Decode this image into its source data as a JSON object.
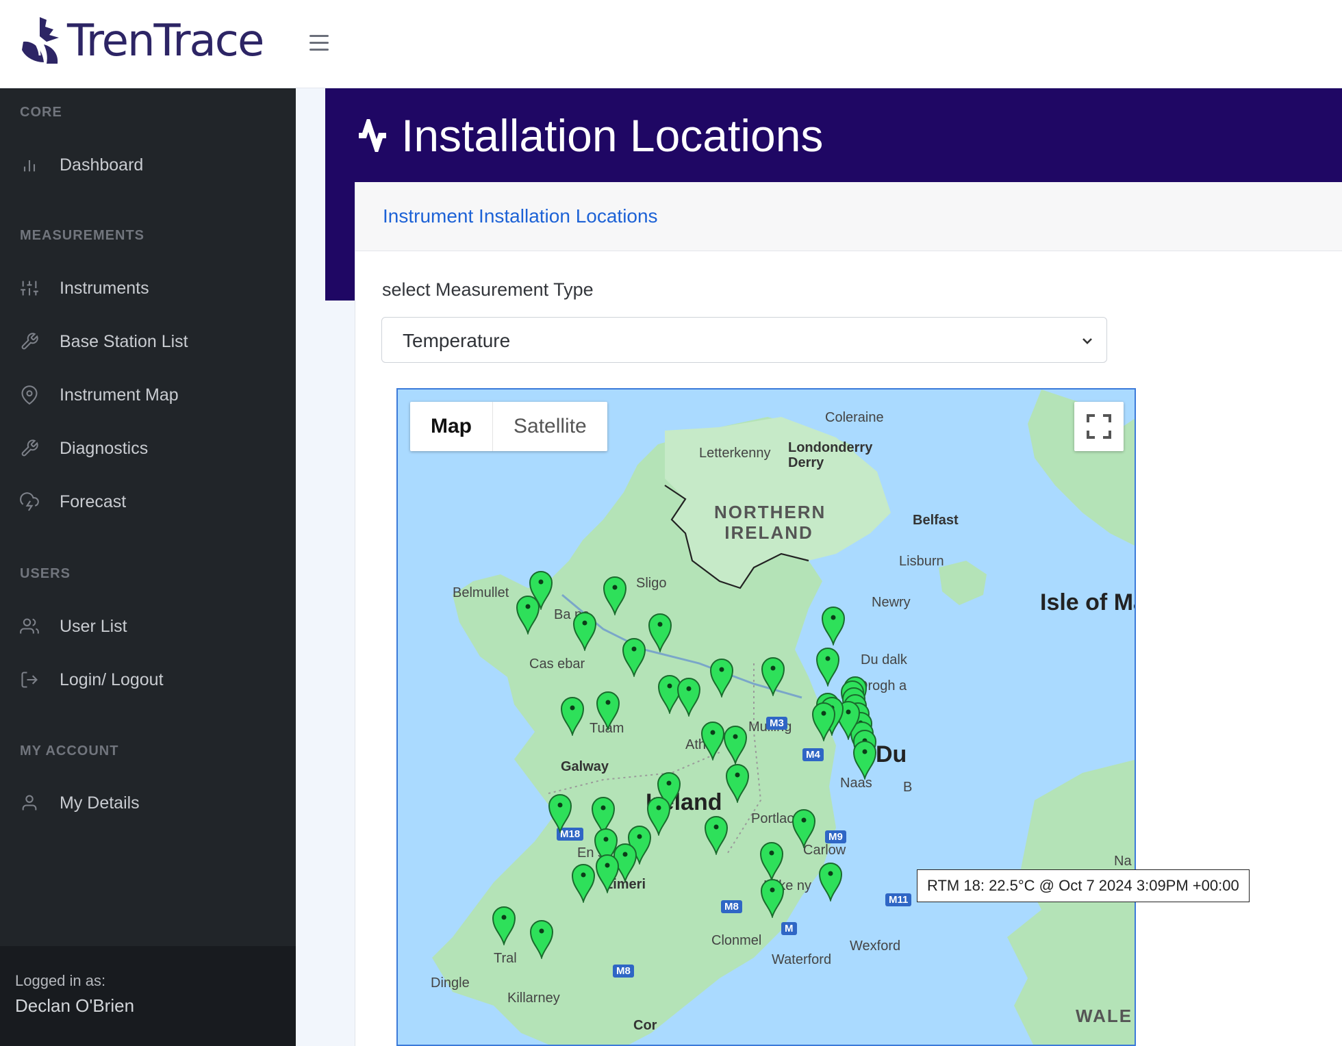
{
  "brand": {
    "name": "TrenTrace"
  },
  "sidebar": {
    "sections": [
      {
        "heading": "CORE",
        "items": [
          {
            "label": "Dashboard",
            "icon": "bar-chart-icon"
          }
        ]
      },
      {
        "heading": "MEASUREMENTS",
        "items": [
          {
            "label": "Instruments",
            "icon": "sliders-icon"
          },
          {
            "label": "Base Station List",
            "icon": "wrench-icon"
          },
          {
            "label": "Instrument Map",
            "icon": "map-pin-icon"
          },
          {
            "label": "Diagnostics",
            "icon": "wrench-icon"
          },
          {
            "label": "Forecast",
            "icon": "cloud-lightning-icon"
          }
        ]
      },
      {
        "heading": "USERS",
        "items": [
          {
            "label": "User List",
            "icon": "users-icon"
          },
          {
            "label": "Login/ Logout",
            "icon": "logout-icon"
          }
        ]
      },
      {
        "heading": "MY ACCOUNT",
        "items": [
          {
            "label": "My Details",
            "icon": "user-icon"
          }
        ]
      }
    ],
    "footer": {
      "logged_in_label": "Logged in as:",
      "user_name": "Declan O'Brien"
    }
  },
  "header": {
    "title": "Installation Locations",
    "icon": "activity-icon"
  },
  "card": {
    "title": "Instrument Installation Locations",
    "select_label": "select Measurement Type",
    "select_value": "Temperature"
  },
  "map": {
    "type_buttons": [
      "Map",
      "Satellite"
    ],
    "selected_type": "Map",
    "fullscreen_icon": "fullscreen-icon",
    "place_labels": {
      "coleraine": "Coleraine",
      "letterkenny": "Letterkenny",
      "londonderry": "Londonderry",
      "derry": "Derry",
      "northern_ireland": "NORTHERN IRELAND",
      "belfast": "Belfast",
      "lisburn": "Lisburn",
      "isle_of_man": "Isle of Ma",
      "belmullet": "Belmullet",
      "sligo": "Sligo",
      "newry": "Newry",
      "ballina": "Ba    na",
      "castlebar": "Cas   ebar",
      "dundalk": "Du    dalk",
      "drogheda": "Drogh     a",
      "tuam": "Tuam",
      "mullingar": "Mulling",
      "athlone": "Athl",
      "galway": "Galway",
      "naas": "Naas",
      "dublin": "Du",
      "bray": "B",
      "ireland": "Ireland",
      "portlaoise": "Portlaois",
      "ennis": "En   s",
      "carlow": "Carlow",
      "limerick": "Limeri",
      "kilkenny": "Kilke    ny",
      "clonmel": "Clonmel",
      "wexford": "Wexford",
      "waterford": "Waterford",
      "tralee": "Tral",
      "dingle": "Dingle",
      "killarney": "Killarney",
      "cork": "Cor",
      "wales": "WALE",
      "na": "Na"
    },
    "road_labels": {
      "m3": "M3",
      "m4": "M4",
      "m18": "M18",
      "m9": "M9",
      "m8a": "M8",
      "m11": "M11",
      "m8b": "M8",
      "m": "M"
    },
    "marker_color": "#2ee05a",
    "marker_count": 46,
    "tooltip": "RTM 18: 22.5°C @ Oct  7 2024  3:09PM +00:00"
  }
}
